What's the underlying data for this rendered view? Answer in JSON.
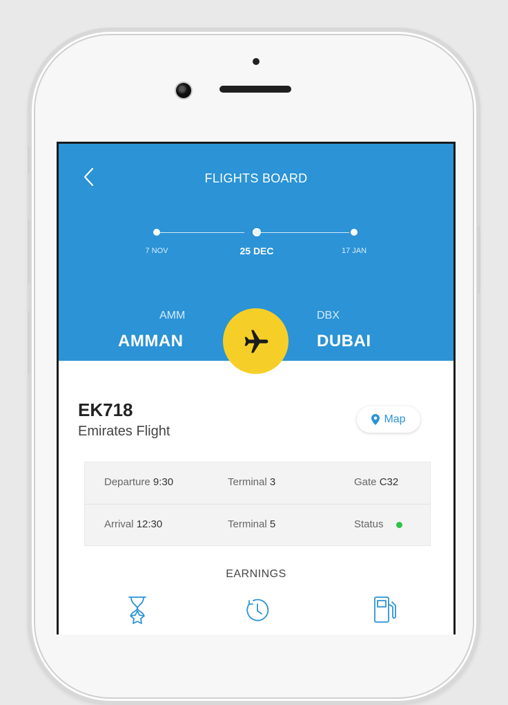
{
  "header": {
    "title": "FLIGHTS BOARD"
  },
  "timeline": {
    "dates": [
      {
        "label": "7 NOV",
        "active": false
      },
      {
        "label": "25 DEC",
        "active": true
      },
      {
        "label": "17 JAN",
        "active": false
      }
    ]
  },
  "route": {
    "origin": {
      "code": "AMM",
      "name": "AMMAN"
    },
    "destination": {
      "code": "DBX",
      "name": "DUBAI"
    }
  },
  "flight": {
    "number": "EK718",
    "airline": "Emirates Flight",
    "map_label": "Map"
  },
  "details": {
    "departure_label": "Departure",
    "departure_time": "9:30",
    "departure_terminal_label": "Terminal",
    "departure_terminal": "3",
    "gate_label": "Gate",
    "gate": "C32",
    "arrival_label": "Arrival",
    "arrival_time": "12:30",
    "arrival_terminal_label": "Terminal",
    "arrival_terminal": "5",
    "status_label": "Status",
    "status_color": "#2fc24c"
  },
  "earnings": {
    "title": "EARNINGS",
    "icons": [
      "hourglass-star-icon",
      "clock-icon",
      "fuel-pump-icon"
    ]
  },
  "colors": {
    "header": "#2b93d6",
    "accent": "#f5cf28",
    "link": "#2b93d6"
  }
}
